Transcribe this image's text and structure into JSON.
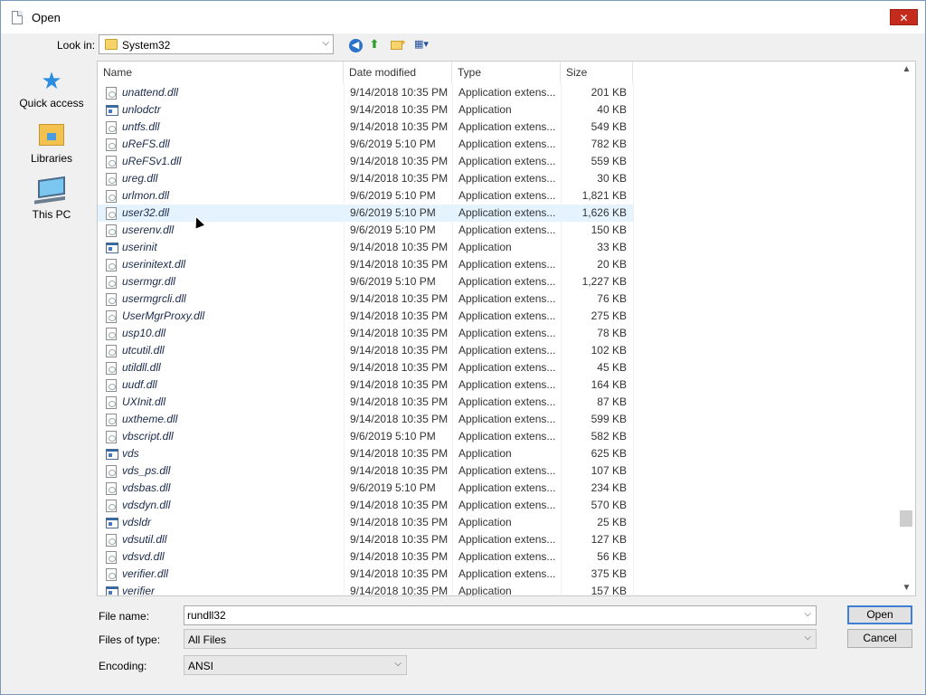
{
  "window": {
    "title": "Open",
    "close_label": "✕"
  },
  "toolbar": {
    "lookin_label": "Look in:",
    "lookin_value": "System32",
    "back_icon": "back-arrow-icon",
    "up_icon": "up-folder-icon",
    "newfolder_icon": "new-folder-icon",
    "views_icon": "views-menu-icon"
  },
  "places": [
    {
      "label": "Quick access",
      "icon": "star-icon"
    },
    {
      "label": "Libraries",
      "icon": "libraries-icon"
    },
    {
      "label": "This PC",
      "icon": "computer-icon"
    }
  ],
  "columns": {
    "name": "Name",
    "date": "Date modified",
    "type": "Type",
    "size": "Size"
  },
  "files": [
    {
      "name": "unattend.dll",
      "date": "9/14/2018 10:35 PM",
      "type": "Application extens...",
      "size": "201 KB",
      "kind": "dll"
    },
    {
      "name": "unlodctr",
      "date": "9/14/2018 10:35 PM",
      "type": "Application",
      "size": "40 KB",
      "kind": "app"
    },
    {
      "name": "untfs.dll",
      "date": "9/14/2018 10:35 PM",
      "type": "Application extens...",
      "size": "549 KB",
      "kind": "dll"
    },
    {
      "name": "uReFS.dll",
      "date": "9/6/2019 5:10 PM",
      "type": "Application extens...",
      "size": "782 KB",
      "kind": "dll"
    },
    {
      "name": "uReFSv1.dll",
      "date": "9/14/2018 10:35 PM",
      "type": "Application extens...",
      "size": "559 KB",
      "kind": "dll"
    },
    {
      "name": "ureg.dll",
      "date": "9/14/2018 10:35 PM",
      "type": "Application extens...",
      "size": "30 KB",
      "kind": "dll"
    },
    {
      "name": "urlmon.dll",
      "date": "9/6/2019 5:10 PM",
      "type": "Application extens...",
      "size": "1,821 KB",
      "kind": "dll"
    },
    {
      "name": "user32.dll",
      "date": "9/6/2019 5:10 PM",
      "type": "Application extens...",
      "size": "1,626 KB",
      "kind": "dll",
      "hover": true
    },
    {
      "name": "userenv.dll",
      "date": "9/6/2019 5:10 PM",
      "type": "Application extens...",
      "size": "150 KB",
      "kind": "dll"
    },
    {
      "name": "userinit",
      "date": "9/14/2018 10:35 PM",
      "type": "Application",
      "size": "33 KB",
      "kind": "app"
    },
    {
      "name": "userinitext.dll",
      "date": "9/14/2018 10:35 PM",
      "type": "Application extens...",
      "size": "20 KB",
      "kind": "dll"
    },
    {
      "name": "usermgr.dll",
      "date": "9/6/2019 5:10 PM",
      "type": "Application extens...",
      "size": "1,227 KB",
      "kind": "dll"
    },
    {
      "name": "usermgrcli.dll",
      "date": "9/14/2018 10:35 PM",
      "type": "Application extens...",
      "size": "76 KB",
      "kind": "dll"
    },
    {
      "name": "UserMgrProxy.dll",
      "date": "9/14/2018 10:35 PM",
      "type": "Application extens...",
      "size": "275 KB",
      "kind": "dll"
    },
    {
      "name": "usp10.dll",
      "date": "9/14/2018 10:35 PM",
      "type": "Application extens...",
      "size": "78 KB",
      "kind": "dll"
    },
    {
      "name": "utcutil.dll",
      "date": "9/14/2018 10:35 PM",
      "type": "Application extens...",
      "size": "102 KB",
      "kind": "dll"
    },
    {
      "name": "utildll.dll",
      "date": "9/14/2018 10:35 PM",
      "type": "Application extens...",
      "size": "45 KB",
      "kind": "dll"
    },
    {
      "name": "uudf.dll",
      "date": "9/14/2018 10:35 PM",
      "type": "Application extens...",
      "size": "164 KB",
      "kind": "dll"
    },
    {
      "name": "UXInit.dll",
      "date": "9/14/2018 10:35 PM",
      "type": "Application extens...",
      "size": "87 KB",
      "kind": "dll"
    },
    {
      "name": "uxtheme.dll",
      "date": "9/14/2018 10:35 PM",
      "type": "Application extens...",
      "size": "599 KB",
      "kind": "dll"
    },
    {
      "name": "vbscript.dll",
      "date": "9/6/2019 5:10 PM",
      "type": "Application extens...",
      "size": "582 KB",
      "kind": "dll"
    },
    {
      "name": "vds",
      "date": "9/14/2018 10:35 PM",
      "type": "Application",
      "size": "625 KB",
      "kind": "app"
    },
    {
      "name": "vds_ps.dll",
      "date": "9/14/2018 10:35 PM",
      "type": "Application extens...",
      "size": "107 KB",
      "kind": "dll"
    },
    {
      "name": "vdsbas.dll",
      "date": "9/6/2019 5:10 PM",
      "type": "Application extens...",
      "size": "234 KB",
      "kind": "dll"
    },
    {
      "name": "vdsdyn.dll",
      "date": "9/14/2018 10:35 PM",
      "type": "Application extens...",
      "size": "570 KB",
      "kind": "dll"
    },
    {
      "name": "vdsldr",
      "date": "9/14/2018 10:35 PM",
      "type": "Application",
      "size": "25 KB",
      "kind": "app"
    },
    {
      "name": "vdsutil.dll",
      "date": "9/14/2018 10:35 PM",
      "type": "Application extens...",
      "size": "127 KB",
      "kind": "dll"
    },
    {
      "name": "vdsvd.dll",
      "date": "9/14/2018 10:35 PM",
      "type": "Application extens...",
      "size": "56 KB",
      "kind": "dll"
    },
    {
      "name": "verifier.dll",
      "date": "9/14/2018 10:35 PM",
      "type": "Application extens...",
      "size": "375 KB",
      "kind": "dll"
    },
    {
      "name": "verifier",
      "date": "9/14/2018 10:35 PM",
      "type": "Application",
      "size": "157 KB",
      "kind": "app"
    }
  ],
  "form": {
    "filename_label": "File name:",
    "filename_value": "rundll32",
    "filetype_label": "Files of type:",
    "filetype_value": "All Files",
    "encoding_label": "Encoding:",
    "encoding_value": "ANSI",
    "open_label": "Open",
    "cancel_label": "Cancel"
  },
  "colors": {
    "accent": "#3f7fd6",
    "close": "#c42b1c",
    "hover": "#e5f3ff"
  }
}
